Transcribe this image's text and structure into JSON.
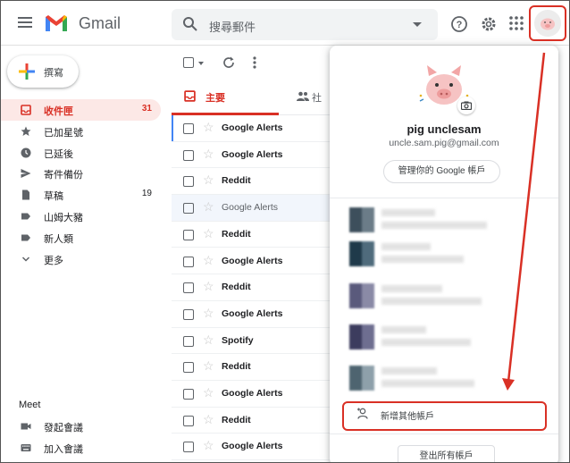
{
  "header": {
    "app_name": "Gmail",
    "search_placeholder": "搜尋郵件"
  },
  "sidebar": {
    "compose_label": "撰寫",
    "items": [
      {
        "label": "收件匣",
        "count": "31",
        "icon": "inbox-icon",
        "active": true
      },
      {
        "label": "已加星號",
        "count": "",
        "icon": "star-icon"
      },
      {
        "label": "已延後",
        "count": "",
        "icon": "clock-icon"
      },
      {
        "label": "寄件備份",
        "count": "",
        "icon": "send-icon"
      },
      {
        "label": "草稿",
        "count": "19",
        "icon": "draft-icon"
      },
      {
        "label": "山姆大豬",
        "count": "",
        "icon": "label-icon"
      },
      {
        "label": "新人類",
        "count": "",
        "icon": "label-icon"
      },
      {
        "label": "更多",
        "count": "",
        "icon": "chevron-down-icon"
      }
    ],
    "meet": {
      "title": "Meet",
      "items": [
        {
          "label": "發起會議",
          "icon": "video-icon"
        },
        {
          "label": "加入會議",
          "icon": "keyboard-icon"
        }
      ]
    }
  },
  "tabs": [
    {
      "label": "主要",
      "icon": "inbox-icon",
      "active": true
    },
    {
      "label": "社",
      "icon": "people-icon"
    }
  ],
  "mail_rows": [
    {
      "sender": "Google Alerts",
      "read": false
    },
    {
      "sender": "Google Alerts",
      "read": false
    },
    {
      "sender": "Reddit",
      "read": false
    },
    {
      "sender": "Google Alerts",
      "read": true
    },
    {
      "sender": "Reddit",
      "read": false
    },
    {
      "sender": "Google Alerts",
      "read": false
    },
    {
      "sender": "Reddit",
      "read": false
    },
    {
      "sender": "Google Alerts",
      "read": false
    },
    {
      "sender": "Spotify",
      "read": false
    },
    {
      "sender": "Reddit",
      "read": false
    },
    {
      "sender": "Google Alerts",
      "read": false
    },
    {
      "sender": "Reddit",
      "read": false
    },
    {
      "sender": "Google Alerts",
      "read": false
    }
  ],
  "account_panel": {
    "name": "pig unclesam",
    "email": "uncle.sam.pig@gmail.com",
    "manage_label": "管理你的 Google 帳戶",
    "add_account_label": "新增其他帳戶",
    "signout_label": "登出所有帳戶"
  },
  "colors": {
    "accent_red": "#d93025",
    "annotation_red": "#d93025",
    "active_nav_bg": "#fce8e6"
  }
}
